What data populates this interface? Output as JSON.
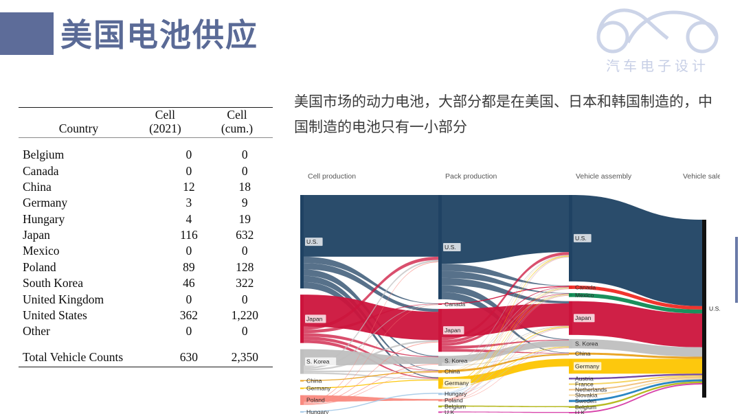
{
  "header": {
    "title": "美国电池供应",
    "block_color": "#5d6c99",
    "title_color": "#5a6a96"
  },
  "logo": {
    "name": "car-outline-logo",
    "caption": "汽车电子设计",
    "color": "#c7cfe6"
  },
  "lead_text": "美国市场的动力电池，大部分都是在美国、日本和韩国制造的，中国制造的电池只有一小部分",
  "table": {
    "columns": [
      "Country",
      "Cell\n(2021)",
      "Cell\n(cum.)"
    ],
    "col_country": "Country",
    "col_cell_2021_l1": "Cell",
    "col_cell_2021_l2": "(2021)",
    "col_cell_cum_l1": "Cell",
    "col_cell_cum_l2": "(cum.)",
    "rows": [
      {
        "country": "Belgium",
        "cell_2021": "0",
        "cell_cum": "0"
      },
      {
        "country": "Canada",
        "cell_2021": "0",
        "cell_cum": "0"
      },
      {
        "country": "China",
        "cell_2021": "12",
        "cell_cum": "18"
      },
      {
        "country": "Germany",
        "cell_2021": "3",
        "cell_cum": "9"
      },
      {
        "country": "Hungary",
        "cell_2021": "4",
        "cell_cum": "19"
      },
      {
        "country": "Japan",
        "cell_2021": "116",
        "cell_cum": "632"
      },
      {
        "country": "Mexico",
        "cell_2021": "0",
        "cell_cum": "0"
      },
      {
        "country": "Poland",
        "cell_2021": "89",
        "cell_cum": "128"
      },
      {
        "country": "South Korea",
        "cell_2021": "46",
        "cell_cum": "322"
      },
      {
        "country": "United Kingdom",
        "cell_2021": "0",
        "cell_cum": "0"
      },
      {
        "country": "United States",
        "cell_2021": "362",
        "cell_cum": "1,220"
      },
      {
        "country": "Other",
        "cell_2021": "0",
        "cell_cum": "0"
      }
    ],
    "total": {
      "label": "Total Vehicle Counts",
      "cell_2021": "630",
      "cell_cum": "2,350"
    }
  },
  "chart_data": {
    "type": "sankey",
    "title": "",
    "stages": [
      "Cell production",
      "Pack production",
      "Vehicle assembly",
      "Vehicle sales"
    ],
    "colors": {
      "U.S.": "#1f4263",
      "Japan": "#cc143c",
      "S. Korea": "#bfbfbf",
      "China": "#e8a11e",
      "Germany": "#fdc500",
      "Poland": "#f98a80",
      "Hungary": "#a9cbe8",
      "Belgium": "#b3b617",
      "U.K": "#d63ca6",
      "Canada": "#ef2a23",
      "Mexico": "#0e8a53",
      "Austria": "#6b3fa0",
      "France": "#f4d35e",
      "Netherlands": "#f0c07a",
      "Slovakia": "#f6d9a0",
      "Sweden": "#1f7fc0",
      "U.S.A.": "#111111"
    },
    "nodes": {
      "cell_production": [
        {
          "label": "U.S.",
          "value": 1220,
          "color": "#1f4263"
        },
        {
          "label": "Japan",
          "value": 632,
          "color": "#cc143c"
        },
        {
          "label": "S. Korea",
          "value": 322,
          "color": "#bfbfbf"
        },
        {
          "label": "China",
          "value": 18,
          "color": "#e8a11e"
        },
        {
          "label": "Germany",
          "value": 9,
          "color": "#fdc500"
        },
        {
          "label": "Poland",
          "value": 128,
          "color": "#f98a80"
        },
        {
          "label": "Hungary",
          "value": 19,
          "color": "#a9cbe8"
        }
      ],
      "pack_production": [
        {
          "label": "U.S.",
          "value": 1360,
          "color": "#1f4263"
        },
        {
          "label": "Canada",
          "value": 10,
          "color": "#cc143c"
        },
        {
          "label": "Japan",
          "value": 560,
          "color": "#cc143c"
        },
        {
          "label": "S. Korea",
          "value": 130,
          "color": "#bfbfbf"
        },
        {
          "label": "China",
          "value": 40,
          "color": "#e8a11e"
        },
        {
          "label": "Germany",
          "value": 150,
          "color": "#fdc500"
        },
        {
          "label": "Hungary",
          "value": 28,
          "color": "#a9cbe8"
        },
        {
          "label": "Poland",
          "value": 30,
          "color": "#f98a80"
        },
        {
          "label": "Belgium",
          "value": 24,
          "color": "#b3b617"
        },
        {
          "label": "U.K",
          "value": 14,
          "color": "#d63ca6"
        }
      ],
      "vehicle_assembly": [
        {
          "label": "U.S.",
          "value": 1100,
          "color": "#1f4263"
        },
        {
          "label": "Canada",
          "value": 44,
          "color": "#ef2a23"
        },
        {
          "label": "Mexico",
          "value": 50,
          "color": "#0e8a53"
        },
        {
          "label": "Japan",
          "value": 430,
          "color": "#cc143c"
        },
        {
          "label": "S. Korea",
          "value": 120,
          "color": "#bfbfbf"
        },
        {
          "label": "China",
          "value": 26,
          "color": "#e8a11e"
        },
        {
          "label": "Germany",
          "value": 190,
          "color": "#fdc500"
        },
        {
          "label": "Austria",
          "value": 20,
          "color": "#6b3fa0"
        },
        {
          "label": "France",
          "value": 12,
          "color": "#f4d35e"
        },
        {
          "label": "Netherlands",
          "value": 12,
          "color": "#f0c07a"
        },
        {
          "label": "Slovakia",
          "value": 14,
          "color": "#f6d9a0"
        },
        {
          "label": "Sweden",
          "value": 26,
          "color": "#1f7fc0"
        },
        {
          "label": "Belgium",
          "value": 22,
          "color": "#b3b617"
        },
        {
          "label": "U.K",
          "value": 14,
          "color": "#d63ca6"
        }
      ],
      "vehicle_sales": [
        {
          "label": "U.S.A.",
          "value": 2350,
          "color": "#111111"
        }
      ]
    }
  },
  "right_accent_bar_color": "#6a7aa8"
}
